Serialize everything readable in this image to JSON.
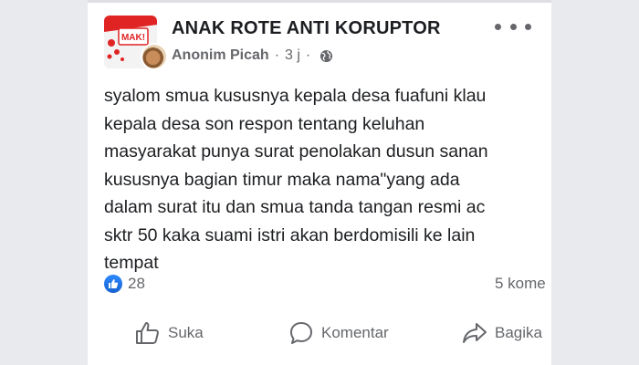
{
  "post": {
    "group_name": "ANAK ROTE ANTI KORUPTOR",
    "author": "Anonim Picah",
    "time": "3 j",
    "separator": "·",
    "avatar_label": "MAK!",
    "body_lines": [
      "syalom smua kususnya kepala desa fuafuni klau",
      "kepala desa son respon tentang keluhan",
      "masyarakat punya surat penolakan dusun sanan",
      "kususnya bagian timur maka nama\"yang ada",
      "dalam surat itu dan smua tanda tangan resmi ac",
      "sktr 50 kaka suami istri akan berdomisili ke lain",
      "tempat"
    ],
    "reactions": "28",
    "comments": "5 kome"
  },
  "actions": {
    "like": "Suka",
    "comment": "Komentar",
    "share": "Bagika"
  },
  "icons": {
    "more": "more-options-icon",
    "audience": "globe-icon",
    "like_reaction": "thumbs-up-icon",
    "comment": "comment-bubble-icon",
    "share": "share-arrow-icon"
  },
  "colors": {
    "text": "#1c1e21",
    "secondary": "#65676b",
    "like_blue": "#1877f2",
    "avatar_red": "#e02424"
  }
}
